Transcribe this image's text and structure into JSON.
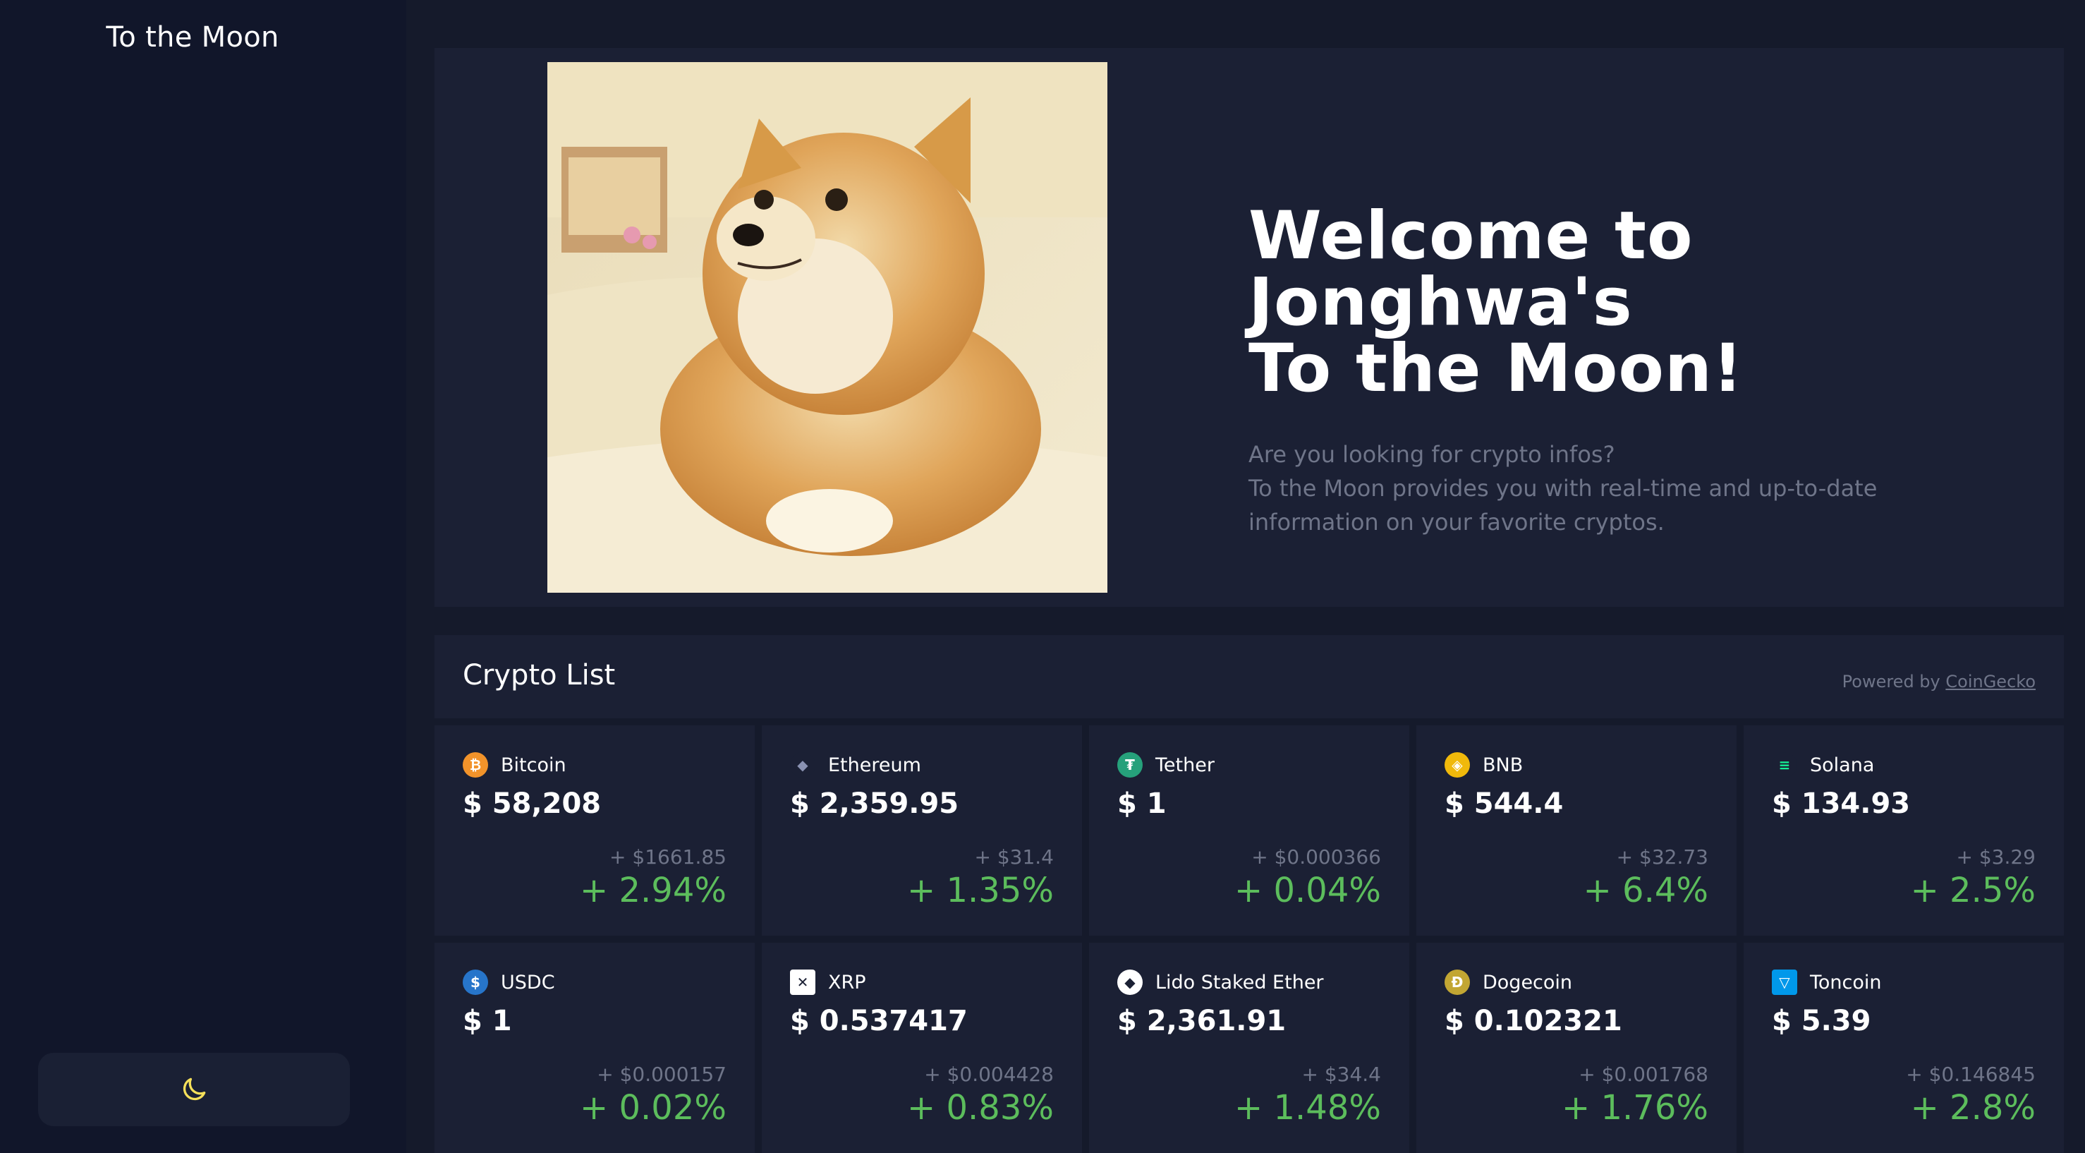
{
  "sidebar": {
    "brand": "To the Moon",
    "theme_toggle_icon": "moon-icon"
  },
  "hero": {
    "image_alt": "Shiba Inu dog",
    "title": "Welcome to\nJonghwa's\nTo the Moon!",
    "subtitle": "Are you looking for crypto infos?\nTo the Moon provides you with real-time and up-to-date\ninformation on your favorite cryptos."
  },
  "list": {
    "title": "Crypto List",
    "powered_by": "Powered by",
    "powered_link": "CoinGecko"
  },
  "colors": {
    "positive": "#5cbd5c",
    "muted": "#6f7589",
    "card": "#1b2034",
    "moon": "#f5e05a"
  },
  "coins": [
    {
      "name": "Bitcoin",
      "price": "$ 58,208",
      "diff": "+ $1661.85",
      "pct": "+ 2.94%",
      "icon": "bitcoin-icon",
      "icon_color": "#f2932a",
      "icon_glyph": "₿"
    },
    {
      "name": "Ethereum",
      "price": "$ 2,359.95",
      "diff": "+ $31.4",
      "pct": "+ 1.35%",
      "icon": "ethereum-icon",
      "icon_color": "#1b2034",
      "icon_glyph": "◆"
    },
    {
      "name": "Tether",
      "price": "$ 1",
      "diff": "+ $0.000366",
      "pct": "+ 0.04%",
      "icon": "tether-icon",
      "icon_color": "#26a17b",
      "icon_glyph": "₮"
    },
    {
      "name": "BNB",
      "price": "$ 544.4",
      "diff": "+ $32.73",
      "pct": "+ 6.4%",
      "icon": "bnb-icon",
      "icon_color": "#f0b90b",
      "icon_glyph": "◈"
    },
    {
      "name": "Solana",
      "price": "$ 134.93",
      "diff": "+ $3.29",
      "pct": "+ 2.5%",
      "icon": "solana-icon",
      "icon_color": "#1b2034",
      "icon_glyph": "≡"
    },
    {
      "name": "USDC",
      "price": "$ 1",
      "diff": "+ $0.000157",
      "pct": "+ 0.02%",
      "icon": "usdc-icon",
      "icon_color": "#2775ca",
      "icon_glyph": "$"
    },
    {
      "name": "XRP",
      "price": "$ 0.537417",
      "diff": "+ $0.004428",
      "pct": "+ 0.83%",
      "icon": "xrp-icon",
      "icon_color": "#ffffff",
      "icon_glyph": "✕"
    },
    {
      "name": "Lido Staked Ether",
      "price": "$ 2,361.91",
      "diff": "+ $34.4",
      "pct": "+ 1.48%",
      "icon": "lido-icon",
      "icon_color": "#ffffff",
      "icon_glyph": "◆"
    },
    {
      "name": "Dogecoin",
      "price": "$ 0.102321",
      "diff": "+ $0.001768",
      "pct": "+ 1.76%",
      "icon": "dogecoin-icon",
      "icon_color": "#c2a633",
      "icon_glyph": "Ð"
    },
    {
      "name": "Toncoin",
      "price": "$ 5.39",
      "diff": "+ $0.146845",
      "pct": "+ 2.8%",
      "icon": "toncoin-icon",
      "icon_color": "#0098ea",
      "icon_glyph": "▽"
    }
  ]
}
